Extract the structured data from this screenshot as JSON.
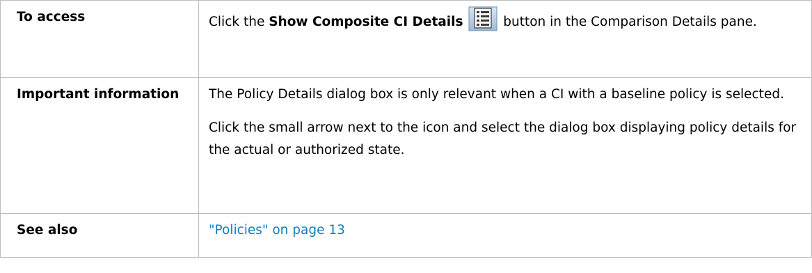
{
  "rows": [
    {
      "label": "To access",
      "content": {
        "prefix": "Click the ",
        "bold": "Show Composite CI Details",
        "icon": "composite-ci-details-icon",
        "suffix": " button in the Comparison Details pane."
      }
    },
    {
      "label": "Important information",
      "paragraphs": [
        "The Policy Details dialog box is only relevant when a CI with a baseline policy is selected.",
        "Click the small arrow next to the icon and select the dialog box displaying policy details for the actual or authorized state."
      ]
    },
    {
      "label": "See also",
      "link": "\"Policies\" on page 13"
    }
  ],
  "colors": {
    "border": "#bcbcbc",
    "link": "#0d80c1"
  }
}
